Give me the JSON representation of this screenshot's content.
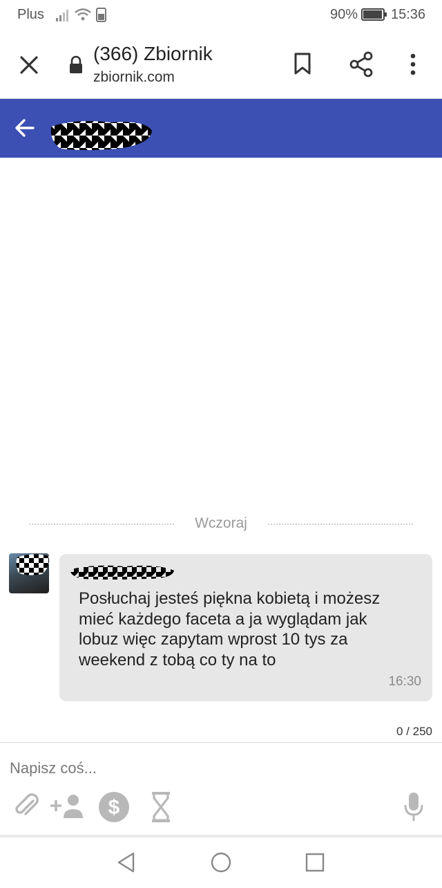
{
  "status_bar": {
    "carrier": "Plus",
    "battery": "90%",
    "time": "15:36"
  },
  "browser": {
    "title": "(366) Zbiornik",
    "url": "zbiornik.com"
  },
  "chat": {
    "date_separator": "Wczoraj",
    "message": {
      "text": "Posłuchaj jesteś piękna kobietą i możesz mieć każdego faceta a ja wyglądam jak lobuz więc zapytam wprost 10 tys za weekend z tobą co ty na to",
      "time": "16:30"
    }
  },
  "composer": {
    "counter": "0 / 250",
    "placeholder": "Napisz coś...",
    "actions": [
      "attach-icon",
      "add-user-icon",
      "dollar-icon",
      "hourglass-icon",
      "microphone-icon"
    ]
  },
  "colors": {
    "header": "#3c50b4",
    "bubble": "#e7e7e7"
  }
}
